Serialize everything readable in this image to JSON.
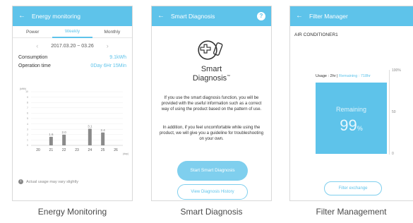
{
  "screens": {
    "energy": {
      "title": "Energy monitoring",
      "tabs": [
        "Power",
        "Weekly",
        "Monthly"
      ],
      "date_range": "2017.03.20 ~ 03.26",
      "consumption_label": "Consumption",
      "consumption_value": "9.1kWh",
      "operation_label": "Operation time",
      "operation_value": "0Day 6Hr 15Min",
      "note": "Actual usage may vary slightly",
      "caption": "Energy Monitoring"
    },
    "diagnosis": {
      "title": "Smart Diagnosis",
      "help": "?",
      "logo_line1": "Smart",
      "logo_line2": "Diagnosis",
      "trademark": "™",
      "desc1": "If you use the smart diagnosis function, you will be provided with the useful information such as a correct way of using the product based on the pattern of use.",
      "desc2": "In addition, if you feel uncomfortable while using the product, we will give you a guideline for troubleshooting on your own.",
      "start_button": "Start Smart Diagnosis",
      "history_button": "View Diagnosis History",
      "caption": "Smart Diagnosis"
    },
    "filter": {
      "title": "Filter Manager",
      "device": "AIR CONDITIONER1",
      "usage": "Usage : 2hr",
      "remaining_text": "Remaining : 718hr",
      "remaining_label": "Remaining",
      "remaining_percent": "99",
      "percent_sign": "%",
      "remaining_fraction": 0.99,
      "axis": [
        "100%",
        "50",
        "0"
      ],
      "exchange_button": "Filter exchange",
      "caption": "Filter Management"
    }
  },
  "chart_data": {
    "type": "bar",
    "title": "",
    "xlabel": "(day)",
    "ylabel": "(kWh)",
    "categories": [
      "20",
      "21",
      "22",
      "23",
      "24",
      "25",
      "26"
    ],
    "values": [
      0,
      1.6,
      2.0,
      0,
      3.1,
      2.4,
      0
    ],
    "data_labels": [
      "",
      "1.6",
      "2.0",
      "",
      "3.1",
      "2.4",
      ""
    ],
    "ylim": [
      0,
      10
    ],
    "y_ticks": [
      "10",
      "9",
      "8",
      "7",
      "6",
      "5",
      "4",
      "3",
      "2",
      "1",
      "0"
    ],
    "grid": true,
    "bar_color": "#8a8a8a"
  },
  "colors": {
    "accent": "#5ec3ea"
  }
}
